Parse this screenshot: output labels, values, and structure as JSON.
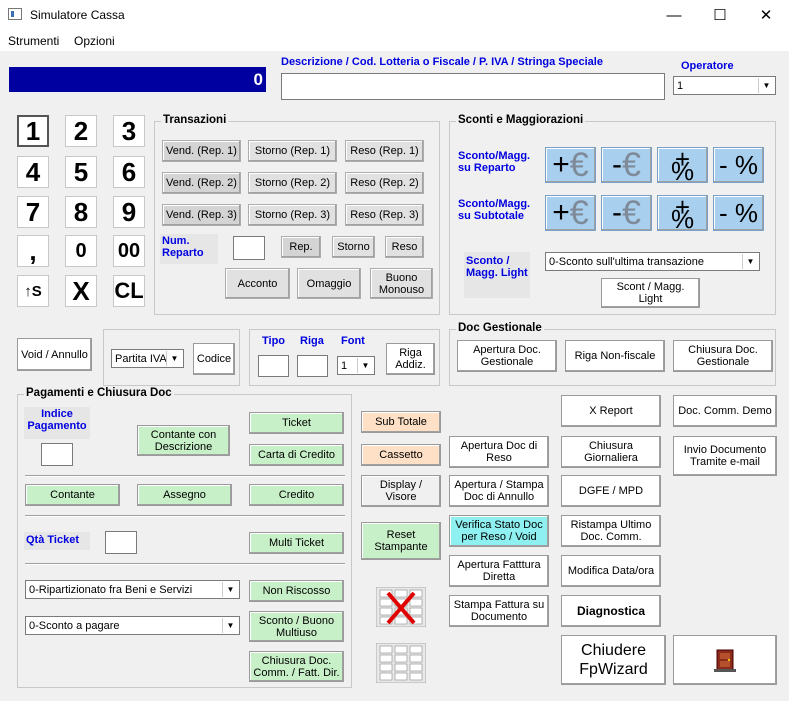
{
  "window": {
    "title": "Simulatore Cassa",
    "minimize": "—",
    "maximize": "☐",
    "close": "✕"
  },
  "menu": [
    "Strumenti",
    "Opzioni"
  ],
  "display": {
    "value": "0"
  },
  "descrizione": {
    "label": "Descrizione / Cod. Lotteria o Fiscale / P. IVA / Stringa Speciale",
    "value": ""
  },
  "operatore": {
    "label": "Operatore",
    "value": "1"
  },
  "keypad": [
    "1",
    "2",
    "3",
    "4",
    "5",
    "6",
    "7",
    "8",
    "9",
    ",",
    "0",
    "00",
    "↑S",
    "X",
    "CL"
  ],
  "transazioni": {
    "title": "Transazioni",
    "vend": [
      "Vend. (Rep. 1)",
      "Vend. (Rep. 2)",
      "Vend. (Rep. 3)"
    ],
    "storno": [
      "Storno (Rep. 1)",
      "Storno (Rep. 2)",
      "Storno (Rep. 3)"
    ],
    "reso": [
      "Reso (Rep. 1)",
      "Reso (Rep. 2)",
      "Reso (Rep. 3)"
    ],
    "num_reparto": "Num. Reparto",
    "rep": "Rep.",
    "storno_btn": "Storno",
    "reso_btn": "Reso",
    "acconto": "Acconto",
    "omaggio": "Omaggio",
    "buono": "Buono Monouso"
  },
  "sconti": {
    "title": "Sconti e Maggiorazioni",
    "reparto": "Sconto/Magg. su Reparto",
    "subtotale": "Sconto/Magg. su Subtotale",
    "light": "Sconto / Magg. Light",
    "light_select": "0-Sconto sull'ultima transazione",
    "light_btn": "Scont / Magg. Light",
    "plus_euro": "+",
    "minus_euro": "-",
    "plus_pct": "+ %",
    "minus_pct": "- %",
    "euro": "€"
  },
  "void": "Void / Annullo",
  "partita": {
    "select": "Partita IVA",
    "codice": "Codice"
  },
  "riga": {
    "tipo": "Tipo",
    "riga": "Riga",
    "font": "Font",
    "font_value": "1",
    "riga_addiz": "Riga Addiz."
  },
  "doc_gestionale": {
    "title": "Doc Gestionale",
    "apertura": "Apertura Doc. Gestionale",
    "riga_nf": "Riga Non-fiscale",
    "chiusura": "Chiusura Doc. Gestionale"
  },
  "pagamenti": {
    "title": "Pagamenti e Chiusura Doc",
    "indice": "Indice Pagamento",
    "contante_desc": "Contante con Descrizione",
    "ticket": "Ticket",
    "carta": "Carta di Credito",
    "contante": "Contante",
    "assegno": "Assegno",
    "credito": "Credito",
    "qta_ticket": "Qtà Ticket",
    "multi_ticket": "Multi Ticket",
    "select1": "0-Ripartizionato fra Beni e Servizi",
    "non_riscosso": "Non Riscosso",
    "select2": "0-Sconto a pagare",
    "sconto_buono": "Sconto / Buono Multiuso",
    "chiusura": "Chiusura Doc. Comm. / Fatt. Dir."
  },
  "middle": {
    "subtotale": "Sub Totale",
    "cassetto": "Cassetto",
    "display": "Display / Visore",
    "reset": "Reset Stampante"
  },
  "right": {
    "apertura_reso": "Apertura Doc di Reso",
    "apertura_annullo": "Apertura / Stampa Doc di Annullo",
    "verifica": "Verifica Stato Doc per Reso / Void",
    "apertura_fattura": "Apertura Fatttura Diretta",
    "stampa_fattura": "Stampa Fattura su Documento",
    "x_report": "X Report",
    "chiusura_giorn": "Chiusura Giornaliera",
    "dgfe": "DGFE / MPD",
    "ristampa": "Ristampa Ultimo Doc. Comm.",
    "modifica": "Modifica Data/ora",
    "diagnostica": "Diagnostica",
    "doc_demo": "Doc. Comm. Demo",
    "invio": "Invio Documento Tramite e-mail",
    "chiudere": "Chiudere FpWizard"
  }
}
